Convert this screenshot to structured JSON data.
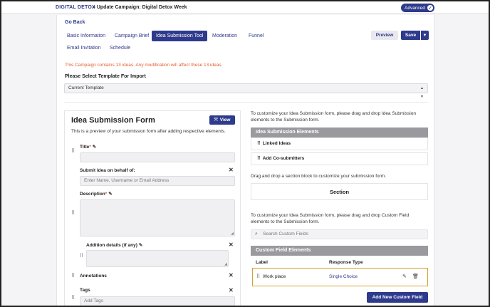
{
  "header": {
    "brand": "DIGITAL DETOX",
    "breadcrumb": "» Update Campaign: Digital Detox Week",
    "advanced_label": "Advanced"
  },
  "nav": {
    "go_back": "Go Back",
    "tabs": [
      {
        "label": "Basic Information"
      },
      {
        "label": "Campaign Brief"
      },
      {
        "label": "Idea Submission Tool"
      },
      {
        "label": "Moderation"
      },
      {
        "label": "Funnel"
      },
      {
        "label": "Email Invitation"
      },
      {
        "label": "Schedule"
      }
    ],
    "active_tab": "Idea Submission Tool"
  },
  "actions": {
    "preview": "Preview",
    "save": "Save"
  },
  "notice": "This Campaign contains 13 ideas. Any modification will affect these 13 ideas.",
  "template": {
    "label": "Please Select Template For Import",
    "value": "Current Template"
  },
  "form": {
    "title": "Idea Submission Form",
    "view_label": "View",
    "description": "This is a preview of your submission form after adding respective elements.",
    "fields": {
      "title": {
        "label": "Title",
        "required": "*"
      },
      "behalf": {
        "label": "Submit idea on behalf of:",
        "placeholder": "Enter Name, Username or Email Address"
      },
      "description": {
        "label": "Description",
        "required": "*"
      },
      "additional": {
        "label": "Addition details (if any)"
      },
      "annotations": {
        "label": "Annotations"
      },
      "tags": {
        "label": "Tags",
        "placeholder": "Add Tags"
      }
    }
  },
  "builder": {
    "intro": "To customize your Idea Submission form, please drag and drop Idea Submission elements to the Submission form.",
    "elements_header": "Idea Submission Elements",
    "elements": [
      {
        "label": "Linked Ideas"
      },
      {
        "label": "Add Co-submitters"
      }
    ],
    "section_intro": "Drag and drop a section block to customize your submission form.",
    "section_label": "Section",
    "custom_intro": "To customize your Idea Submission form, please drag and drop Custom Field elements to the Submission form.",
    "search_placeholder": "Search Custom Fields",
    "custom_header": "Custom Field Elements",
    "columns": {
      "label": "Label",
      "response_type": "Response Type"
    },
    "rows": [
      {
        "label": "Work place",
        "response_type": "Single Choice"
      }
    ],
    "add_button": "Add New Custom Field"
  },
  "colors": {
    "primary": "#2e3a8c",
    "warning": "#e06030",
    "highlight": "#d4a030"
  }
}
